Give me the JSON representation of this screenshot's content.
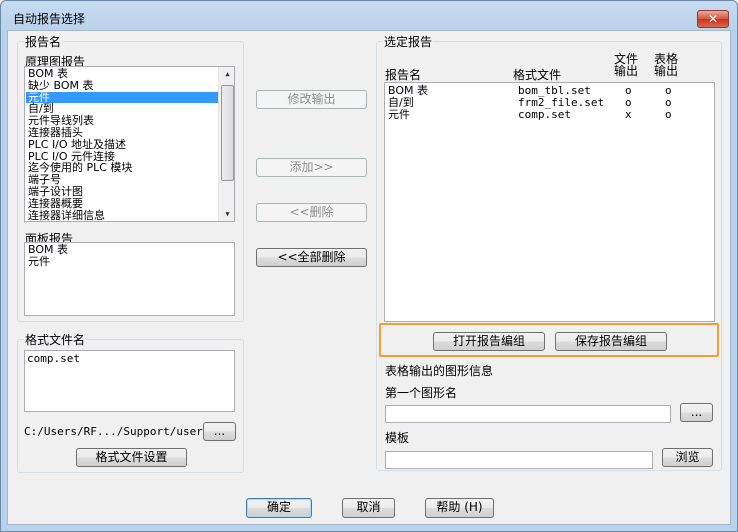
{
  "window": {
    "title": "自动报告选择",
    "close_glyph": "✕"
  },
  "report_name_group": {
    "label": "报告名",
    "schematic_label": "原理图报告",
    "schematic_items": [
      "BOM 表",
      "缺少 BOM 表",
      "元件",
      "自/到",
      "元件导线列表",
      "连接器插头",
      "PLC I/O 地址及描述",
      "PLC I/O 元件连接",
      "迄今使用的 PLC 模块",
      "端子号",
      "端子设计图",
      "连接器概要",
      "连接器详细信息"
    ],
    "schematic_selected_index": 2,
    "panel_label": "面板报告",
    "panel_items": [
      "BOM 表",
      "元件"
    ]
  },
  "format_group": {
    "label": "格式文件名",
    "items": [
      "comp.set"
    ],
    "path": "C:/Users/RF.../Support/user/",
    "browse_label": "...",
    "settings_button": "格式文件设置"
  },
  "middle_buttons": {
    "modify_output": "修改输出",
    "add": "添加>>",
    "delete": "<<删除",
    "delete_all": "<<全部删除"
  },
  "selected_group": {
    "label": "选定报告",
    "col_report": "报告名",
    "col_format": "格式文件",
    "col_file_out": "文件输出",
    "col_table_out": "表格输出",
    "rows": [
      {
        "name": "BOM 表",
        "format": "bom_tbl.set",
        "file": "o",
        "table": "o"
      },
      {
        "name": "自/到",
        "format": "frm2_file.set",
        "file": "o",
        "table": "o"
      },
      {
        "name": "元件",
        "format": "comp.set",
        "file": "x",
        "table": "o"
      }
    ],
    "open_group_button": "打开报告编组",
    "save_group_button": "保存报告编组"
  },
  "table_graphics": {
    "label": "表格输出的图形信息",
    "first_graphic_label": "第一个图形名",
    "first_graphic_value": "",
    "first_browse": "...",
    "template_label": "模板",
    "template_value": "",
    "template_browse": "浏览"
  },
  "footer": {
    "ok": "确定",
    "cancel": "取消",
    "help": "帮助 (H)"
  },
  "colors": {
    "selection": "#3399ff",
    "highlight_border": "#f0a030"
  }
}
